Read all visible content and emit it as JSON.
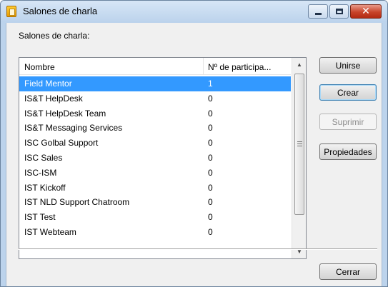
{
  "window": {
    "title": "Salones de charla",
    "close_glyph": "✕"
  },
  "dialog": {
    "label": "Salones de charla:"
  },
  "list": {
    "columns": [
      "Nombre",
      "Nº de participa..."
    ],
    "rows": [
      {
        "name": "Field Mentor",
        "participants": "1",
        "selected": true
      },
      {
        "name": "IS&T HelpDesk",
        "participants": "0"
      },
      {
        "name": "IS&T HelpDesk Team",
        "participants": "0"
      },
      {
        "name": "IS&T Messaging Services",
        "participants": "0"
      },
      {
        "name": "ISC Golbal Support",
        "participants": "0"
      },
      {
        "name": "ISC Sales",
        "participants": "0"
      },
      {
        "name": "ISC-ISM",
        "participants": "0"
      },
      {
        "name": "IST Kickoff",
        "participants": "0"
      },
      {
        "name": "IST NLD Support Chatroom",
        "participants": "0"
      },
      {
        "name": "IST Test",
        "participants": "0"
      },
      {
        "name": "IST Webteam",
        "participants": "0"
      }
    ],
    "scroll_up_glyph": "▲",
    "scroll_down_glyph": "▼"
  },
  "buttons": {
    "join": "Unirse",
    "create": "Crear",
    "delete": "Suprimir",
    "properties": "Propiedades",
    "close": "Cerrar"
  },
  "colors": {
    "selection": "#3399ff",
    "title_bar": "#bcd3ec",
    "close_button": "#c8442a"
  },
  "icons": [
    "app-icon",
    "minimize-icon",
    "maximize-icon",
    "close-icon",
    "scroll-up-arrow-icon",
    "scroll-down-arrow-icon"
  ]
}
